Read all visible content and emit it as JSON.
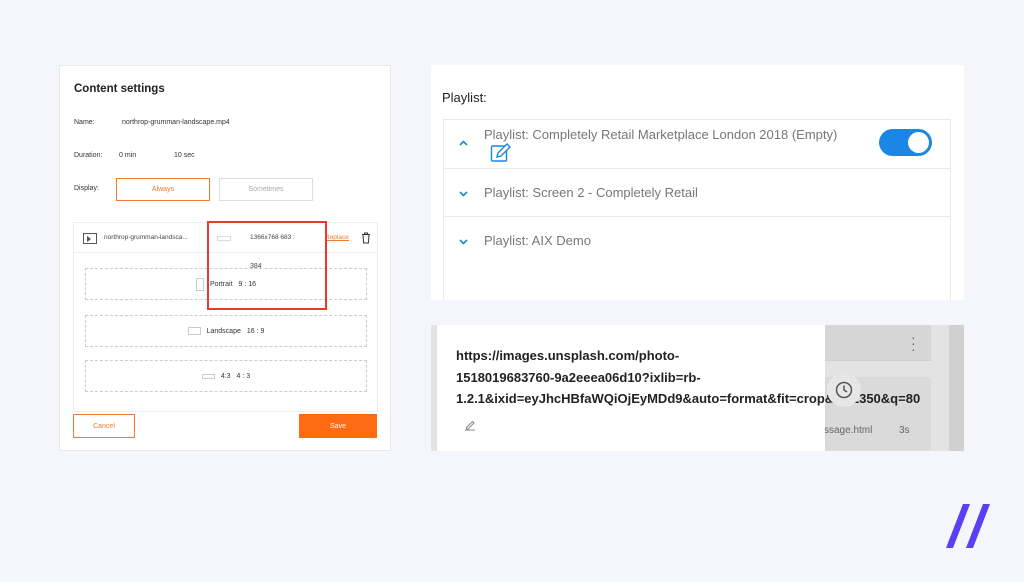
{
  "content_settings": {
    "title": "Content settings",
    "name_label": "Name:",
    "name_value": "northrop-grumman-landscape.mp4",
    "duration_label": "Duration:",
    "duration_min": "0 min",
    "duration_sec": "10 sec",
    "display_label": "Display:",
    "display_always": "Always",
    "display_sometimes": "Sometimes",
    "file_name": "northrop-grumman-landsca...",
    "file_resolution": "1366x768 683 :",
    "replace_label": "Replace",
    "crop_number": "384",
    "crop_options": [
      {
        "name": "Portrait",
        "ratio": "9 : 16"
      },
      {
        "name": "Landscape",
        "ratio": "16 : 9"
      },
      {
        "name": "4:3",
        "ratio": "4 : 3"
      }
    ],
    "cancel_label": "Cancel",
    "save_label": "Save"
  },
  "playlist": {
    "title": "Playlist:",
    "items": [
      {
        "label": "Playlist: Completely Retail Marketplace London 2018 (Empty)",
        "expanded": true,
        "enabled": true
      },
      {
        "label": "Playlist: Screen 2 - Completely Retail",
        "expanded": false
      },
      {
        "label": "Playlist: AIX Demo",
        "expanded": false
      }
    ]
  },
  "url_panel": {
    "url_lines": [
      "https://images.unsplash.com/photo-",
      "1518019683760-9a2eeea06d10?ixlib=rb-",
      "1.2.1&ixid=eyJhcHBfaWQiOjEyMDd9&auto=format&fit=crop&w=1350&q=80"
    ],
    "background_file": "ssage.html",
    "background_duration": "3s"
  },
  "colors": {
    "accent_orange": "#ff6a13",
    "toggle_blue": "#1a87e6",
    "highlight_red": "#e8392c",
    "logo_purple": "#5b3ff5"
  }
}
